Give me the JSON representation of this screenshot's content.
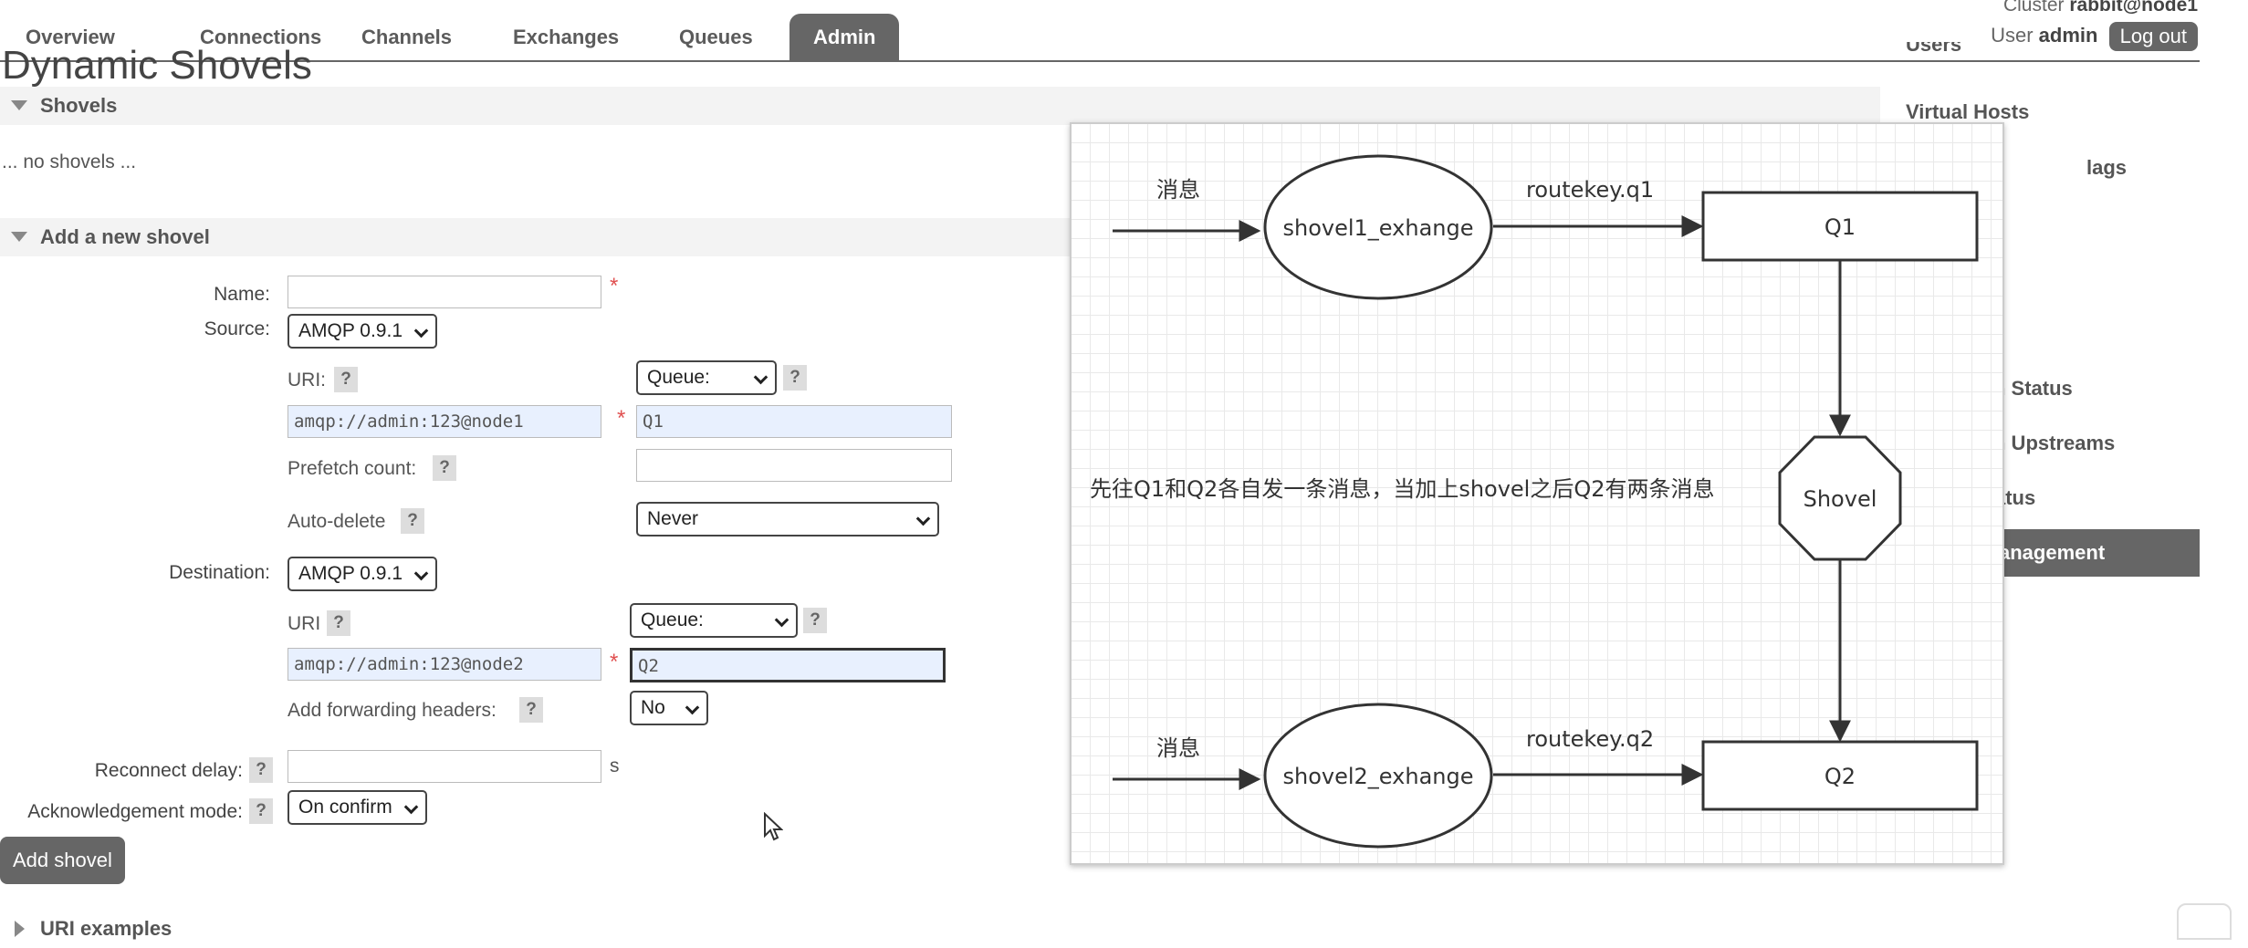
{
  "nav": {
    "tabs": [
      {
        "label": "Overview"
      },
      {
        "label": "Connections"
      },
      {
        "label": "Channels"
      },
      {
        "label": "Exchanges"
      },
      {
        "label": "Queues"
      },
      {
        "label": "Admin"
      }
    ],
    "active_tab": "Admin",
    "cluster_label": "Cluster",
    "cluster_name": "rabbit@node1",
    "user_label": "User",
    "user_name": "admin",
    "logout_label": "Log out"
  },
  "sidebar": {
    "items": [
      {
        "label": "Users"
      },
      {
        "label": "Virtual Hosts"
      },
      {
        "label": "lags"
      },
      {
        "label": "n Status"
      },
      {
        "label": "n Upstreams"
      },
      {
        "label": "atus"
      },
      {
        "label": "anagement"
      }
    ],
    "active_item": "anagement"
  },
  "page": {
    "title": "Dynamic Shovels",
    "shovels_section": "Shovels",
    "no_shovels": "... no shovels ...",
    "add_section": "Add a new shovel",
    "uri_examples_section": "URI examples"
  },
  "form": {
    "name_label": "Name:",
    "name_value": "",
    "source_label": "Source:",
    "source_protocol": "AMQP 0.9.1",
    "src_uri_label": "URI:",
    "src_uri_value": "amqp://admin:123@node1",
    "src_type": "Queue:",
    "src_queue": "Q1",
    "prefetch_label": "Prefetch count:",
    "prefetch_value": "",
    "autodelete_label": "Auto-delete",
    "autodelete_value": "Never",
    "destination_label": "Destination:",
    "dest_protocol": "AMQP 0.9.1",
    "dest_uri_label": "URI",
    "dest_uri_value": "amqp://admin:123@node2",
    "dest_type": "Queue:",
    "dest_queue": "Q2",
    "fwd_headers_label": "Add forwarding headers:",
    "fwd_headers_value": "No",
    "reconnect_label": "Reconnect delay:",
    "reconnect_value": "",
    "reconnect_unit": "s",
    "ack_label": "Acknowledgement mode:",
    "ack_value": "On confirm",
    "submit_label": "Add shovel",
    "help_glyph": "?",
    "required_glyph": "*"
  },
  "diagram": {
    "msg1": "消息",
    "exchange1": "shovel1_exhange",
    "key1": "routekey.q1",
    "queue1": "Q1",
    "shovel": "Shovel",
    "note": "先往Q1和Q2各自发一条消息，当加上shovel之后Q2有两条消息",
    "msg2": "消息",
    "exchange2": "shovel2_exhange",
    "key2": "routekey.q2",
    "queue2": "Q2"
  }
}
